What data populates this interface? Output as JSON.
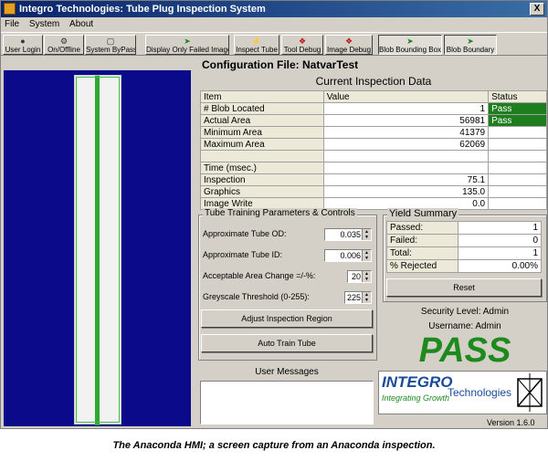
{
  "window": {
    "title": "Integro Technologies: Tube Plug Inspection System",
    "close_label": "X"
  },
  "menu": [
    "File",
    "System",
    "About"
  ],
  "toolbar": [
    {
      "label": "User Login",
      "icon": "person-icon"
    },
    {
      "label": "On/Offline",
      "icon": "gears-icon"
    },
    {
      "label": "System ByPass",
      "icon": "bypass-icon"
    },
    {
      "label": "Display Only Failed Images",
      "icon": "arrow-icon"
    },
    {
      "label": "Inspect Tube",
      "icon": "bolt-icon"
    },
    {
      "label": "Tool Debug",
      "icon": "red-icon"
    },
    {
      "label": "Image Debug",
      "icon": "red-icon"
    },
    {
      "label": "Blob Bounding Box",
      "icon": "arrow-icon"
    },
    {
      "label": "Blob Boundary",
      "icon": "arrow-icon"
    }
  ],
  "config": {
    "title": "Configuration File: NatvarTest"
  },
  "inspection": {
    "title": "Current Inspection Data",
    "headers": [
      "Item",
      "Value",
      "Status"
    ],
    "rows": [
      {
        "item": "# Blob Located",
        "value": "1",
        "status": "Pass"
      },
      {
        "item": "Actual Area",
        "value": "56981",
        "status": "Pass"
      },
      {
        "item": "Minimum Area",
        "value": "41379",
        "status": ""
      },
      {
        "item": "Maximum Area",
        "value": "62069",
        "status": ""
      },
      {
        "item": "",
        "value": "",
        "status": ""
      },
      {
        "item": "Time (msec.)",
        "value": "",
        "status": ""
      },
      {
        "item": "Inspection",
        "value": "75.1",
        "status": ""
      },
      {
        "item": "Graphics",
        "value": "135.0",
        "status": ""
      },
      {
        "item": "Image Write",
        "value": "0.0",
        "status": ""
      }
    ]
  },
  "training": {
    "title": "Tube Training Parameters & Controls",
    "params": [
      {
        "label": "Approximate Tube OD:",
        "value": "0.035"
      },
      {
        "label": "Approximate Tube ID:",
        "value": "0.006"
      },
      {
        "label": "Acceptable Area Change =/-%:",
        "value": "20"
      },
      {
        "label": "Greyscale Threshold (0-255):",
        "value": "225"
      }
    ],
    "adjust_button": "Adjust Inspection Region",
    "auto_train_button": "Auto Train Tube"
  },
  "yield": {
    "title": "Yield Summary",
    "rows": [
      {
        "label": "Passed:",
        "value": "1"
      },
      {
        "label": "Failed:",
        "value": "0"
      },
      {
        "label": "Total:",
        "value": "1"
      },
      {
        "label": "% Rejected",
        "value": "0.00%"
      }
    ],
    "reset_button": "Reset"
  },
  "status": {
    "security": "Security Level: Admin",
    "username": "Username: Admin",
    "result": "PASS",
    "result_color": "#1e8a1e"
  },
  "logo": {
    "word": "INTEGRO",
    "sub": "Technologies",
    "tagline": "Integrating Growth"
  },
  "version": "Version 1.6.0",
  "messages": {
    "title": "User Messages"
  },
  "caption": "The Anaconda HMI; a screen capture from an Anaconda inspection."
}
